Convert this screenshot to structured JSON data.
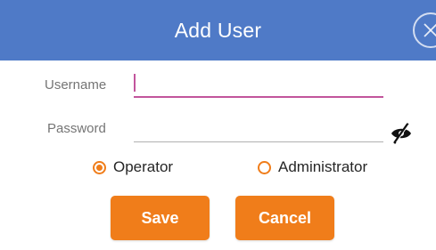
{
  "header": {
    "title": "Add User",
    "background_color": "#4f7ac7",
    "close_icon": "close-circle-icon"
  },
  "form": {
    "username": {
      "label": "Username",
      "value": "",
      "placeholder": "",
      "focused": true,
      "accent_color": "#c2559c"
    },
    "password": {
      "label": "Password",
      "value": "",
      "placeholder": "",
      "visibility_icon": "eye-off-icon"
    },
    "role": {
      "options": [
        {
          "label": "Operator",
          "selected": true
        },
        {
          "label": "Administrator",
          "selected": false
        }
      ],
      "accent_color": "#f07d1a"
    }
  },
  "actions": {
    "save_label": "Save",
    "cancel_label": "Cancel",
    "button_color": "#f07d1a"
  }
}
